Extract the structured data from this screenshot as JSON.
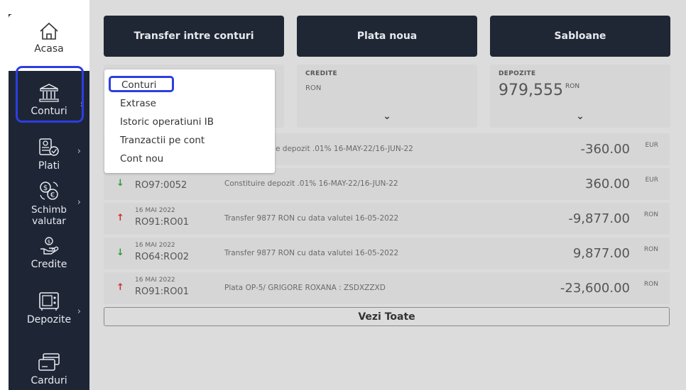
{
  "sidebar": {
    "items": [
      {
        "label": "Acasa",
        "icon": "home-icon"
      },
      {
        "label": "Conturi",
        "icon": "bank-icon"
      },
      {
        "label": "Plati",
        "icon": "payments-icon"
      },
      {
        "label": "Schimb valutar",
        "icon": "currency-exchange-icon"
      },
      {
        "label": "Credite",
        "icon": "credit-hand-icon"
      },
      {
        "label": "Depozite",
        "icon": "safe-icon"
      },
      {
        "label": "Carduri",
        "icon": "card-icon"
      }
    ],
    "chevron": "›"
  },
  "top_buttons": [
    "Transfer intre conturi",
    "Plata noua",
    "Sabloane"
  ],
  "summary_cards": {
    "credite": {
      "title": "CREDITE",
      "currency": "RON"
    },
    "depozite": {
      "title": "DEPOZITE",
      "value": "979,555",
      "currency": "RON"
    },
    "chevron": "⌄"
  },
  "transactions": [
    {
      "direction": "down",
      "date": "",
      "account": "",
      "description": "e depozit .01% 16-MAY-22/16-JUN-22",
      "amount": "-360.00",
      "currency": "EUR"
    },
    {
      "direction": "down",
      "date": "16 MAI 2022",
      "account": "RO97:0052",
      "description": "Constituire depozit .01% 16-MAY-22/16-JUN-22",
      "amount": "360.00",
      "currency": "EUR"
    },
    {
      "direction": "up",
      "date": "16 MAI 2022",
      "account": "RO91:RO01",
      "description": "Transfer 9877 RON cu data valutei 16-05-2022",
      "amount": "-9,877.00",
      "currency": "RON"
    },
    {
      "direction": "down",
      "date": "16 MAI 2022",
      "account": "RO64:RO02",
      "description": "Transfer 9877 RON cu data valutei 16-05-2022",
      "amount": "9,877.00",
      "currency": "RON"
    },
    {
      "direction": "up",
      "date": "16 MAI 2022",
      "account": "RO91:RO01",
      "description": "Plata OP-5/ GRIGORE ROXANA : ZSDXZZXD",
      "amount": "-23,600.00",
      "currency": "RON"
    }
  ],
  "view_all": "Vezi Toate",
  "dropdown": {
    "items": [
      "Conturi",
      "Extrase",
      "Istoric operatiuni IB",
      "Tranzactii pe cont",
      "Cont nou"
    ]
  },
  "colors": {
    "sidebar_bg": "#1e2636",
    "button_bg": "#202734",
    "highlight": "#2d3ee0",
    "arrow_up": "#d62b2b",
    "arrow_down": "#2e9a3c"
  }
}
